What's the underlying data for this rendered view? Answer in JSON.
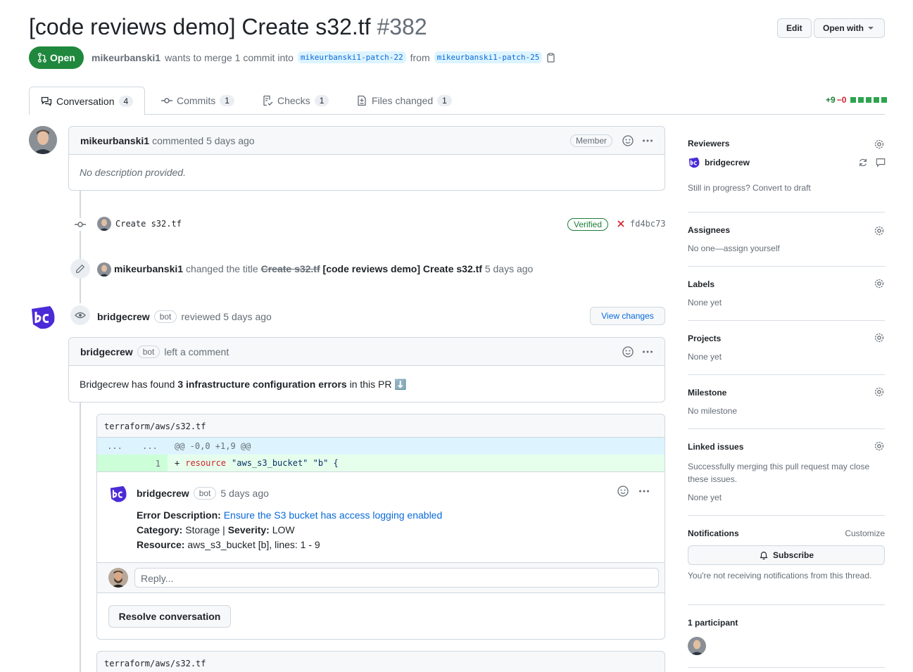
{
  "header": {
    "title": "[code reviews demo] Create s32.tf",
    "number": "#382",
    "edit_label": "Edit",
    "open_with_label": "Open with"
  },
  "pr_state": {
    "label": "Open",
    "author": "mikeurbanski1",
    "merge_text": "wants to merge 1 commit into",
    "base_branch": "mikeurbanski1-patch-22",
    "from_text": "from",
    "head_branch": "mikeurbanski1-patch-25"
  },
  "tabs": [
    {
      "label": "Conversation",
      "count": "4"
    },
    {
      "label": "Commits",
      "count": "1"
    },
    {
      "label": "Checks",
      "count": "1"
    },
    {
      "label": "Files changed",
      "count": "1"
    }
  ],
  "diffstat": {
    "added": "+9",
    "removed": "−0"
  },
  "first_comment": {
    "author": "mikeurbanski1",
    "action": "commented 5 days ago",
    "role": "Member",
    "body": "No description provided."
  },
  "commit": {
    "message": "Create s32.tf",
    "verified": "Verified",
    "sha": "fd4bc73"
  },
  "title_change": {
    "author": "mikeurbanski1",
    "text": "changed the title",
    "old_title": "Create s32.tf",
    "new_title": "[code reviews demo] Create s32.tf",
    "time": "5 days ago"
  },
  "review": {
    "author": "bridgecrew",
    "bot_label": "bot",
    "action": "reviewed 5 days ago",
    "view_changes_label": "View changes"
  },
  "review_comment": {
    "author": "bridgecrew",
    "bot_label": "bot",
    "action": "left a comment",
    "body_pre": "Bridgecrew has found",
    "body_bold": "3 infrastructure configuration errors",
    "body_post": "in this PR",
    "body_emoji": "⬇️"
  },
  "file_block": {
    "path": "terraform/aws/s32.tf",
    "hunk_left": "...",
    "hunk_right": "...",
    "hunk_header": "@@ -0,0 +1,9 @@",
    "line_num": "1",
    "code_plus": "+",
    "code_kw": "resource",
    "code_rest": "\"aws_s3_bucket\" \"b\" {"
  },
  "inline_comment": {
    "author": "bridgecrew",
    "bot_label": "bot",
    "time": "5 days ago",
    "error_label": "Error Description:",
    "error_link": "Ensure the S3 bucket has access logging enabled",
    "category_label": "Category:",
    "category_value": "Storage |",
    "severity_label": "Severity:",
    "severity_value": "LOW",
    "resource_label": "Resource:",
    "resource_value": "aws_s3_bucket [b], lines: 1 - 9",
    "reply_placeholder": "Reply...",
    "resolve_label": "Resolve conversation"
  },
  "second_file_path": "terraform/aws/s32.tf",
  "sidebar": {
    "reviewers_title": "Reviewers",
    "reviewer_name": "bridgecrew",
    "draft_text": "Still in progress? Convert to draft",
    "assignees_title": "Assignees",
    "assignees_value": "No one—assign yourself",
    "labels_title": "Labels",
    "labels_value": "None yet",
    "projects_title": "Projects",
    "projects_value": "None yet",
    "milestone_title": "Milestone",
    "milestone_value": "No milestone",
    "linked_title": "Linked issues",
    "linked_desc": "Successfully merging this pull request may close these issues.",
    "linked_value": "None yet",
    "notifications_title": "Notifications",
    "customize_label": "Customize",
    "subscribe_label": "Subscribe",
    "notif_desc": "You're not receiving notifications from this thread.",
    "participants_title": "1 participant"
  },
  "colors": {
    "open_green": "#1f883d",
    "link_blue": "#0969da",
    "add_bg": "#e6ffec",
    "bc_purple": "#4b2bd8"
  }
}
